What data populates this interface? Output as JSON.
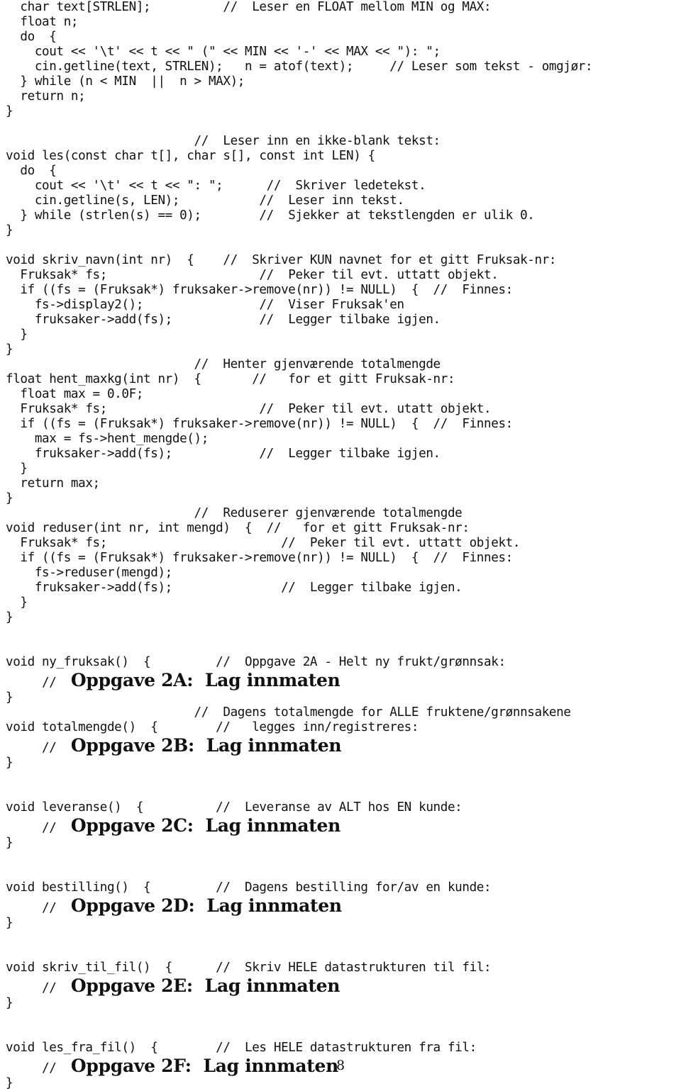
{
  "document": {
    "page_number": "8",
    "language": "no",
    "listing_type": "cpp-source-code"
  },
  "lines": [
    {
      "kind": "code",
      "text": "  char text[STRLEN];          //  Leser en FLOAT mellom MIN og MAX:"
    },
    {
      "kind": "code",
      "text": "  float n;"
    },
    {
      "kind": "code",
      "text": "  do  {"
    },
    {
      "kind": "code",
      "text": "    cout << '\\t' << t << \" (\" << MIN << '-' << MAX << \"): \";"
    },
    {
      "kind": "code",
      "text": "    cin.getline(text, STRLEN);   n = atof(text);     // Leser som tekst - omgjør:"
    },
    {
      "kind": "code",
      "text": "  } while (n < MIN  ||  n > MAX);"
    },
    {
      "kind": "code",
      "text": "  return n;"
    },
    {
      "kind": "code",
      "text": "}"
    },
    {
      "kind": "blank",
      "text": ""
    },
    {
      "kind": "code",
      "text": "                          //  Leser inn en ikke-blank tekst:"
    },
    {
      "kind": "code",
      "text": "void les(const char t[], char s[], const int LEN) {"
    },
    {
      "kind": "code",
      "text": "  do  {"
    },
    {
      "kind": "code",
      "text": "    cout << '\\t' << t << \": \";      //  Skriver ledetekst."
    },
    {
      "kind": "code",
      "text": "    cin.getline(s, LEN);           //  Leser inn tekst."
    },
    {
      "kind": "code",
      "text": "  } while (strlen(s) == 0);        //  Sjekker at tekstlengden er ulik 0."
    },
    {
      "kind": "code",
      "text": "}"
    },
    {
      "kind": "blank",
      "text": ""
    },
    {
      "kind": "code",
      "text": "void skriv_navn(int nr)  {    //  Skriver KUN navnet for et gitt Fruksak-nr:"
    },
    {
      "kind": "code",
      "text": "  Fruksak* fs;                     //  Peker til evt. uttatt objekt."
    },
    {
      "kind": "code",
      "text": "  if ((fs = (Fruksak*) fruksaker->remove(nr)) != NULL)  {  //  Finnes:"
    },
    {
      "kind": "code",
      "text": "    fs->display2();                //  Viser Fruksak'en"
    },
    {
      "kind": "code",
      "text": "    fruksaker->add(fs);            //  Legger tilbake igjen."
    },
    {
      "kind": "code",
      "text": "  }"
    },
    {
      "kind": "code",
      "text": "}"
    },
    {
      "kind": "code",
      "text": "                          //  Henter gjenværende totalmengde"
    },
    {
      "kind": "code",
      "text": "float hent_maxkg(int nr)  {       //   for et gitt Fruksak-nr:"
    },
    {
      "kind": "code",
      "text": "  float max = 0.0F;"
    },
    {
      "kind": "code",
      "text": "  Fruksak* fs;                     //  Peker til evt. utatt objekt."
    },
    {
      "kind": "code",
      "text": "  if ((fs = (Fruksak*) fruksaker->remove(nr)) != NULL)  {  //  Finnes:"
    },
    {
      "kind": "code",
      "text": "    max = fs->hent_mengde();"
    },
    {
      "kind": "code",
      "text": "    fruksaker->add(fs);            //  Legger tilbake igjen."
    },
    {
      "kind": "code",
      "text": "  }"
    },
    {
      "kind": "code",
      "text": "  return max;"
    },
    {
      "kind": "code",
      "text": "}"
    },
    {
      "kind": "code",
      "text": "                          //  Reduserer gjenværende totalmengde"
    },
    {
      "kind": "code",
      "text": "void reduser(int nr, int mengd)  {  //   for et gitt Fruksak-nr:"
    },
    {
      "kind": "code",
      "text": "  Fruksak* fs;                        //  Peker til evt. uttatt objekt."
    },
    {
      "kind": "code",
      "text": "  if ((fs = (Fruksak*) fruksaker->remove(nr)) != NULL)  {  //  Finnes:"
    },
    {
      "kind": "code",
      "text": "    fs->reduser(mengd);"
    },
    {
      "kind": "code",
      "text": "    fruksaker->add(fs);               //  Legger tilbake igjen."
    },
    {
      "kind": "code",
      "text": "  }"
    },
    {
      "kind": "code",
      "text": "}"
    },
    {
      "kind": "blank",
      "text": ""
    },
    {
      "kind": "blank",
      "text": ""
    },
    {
      "kind": "code",
      "text": "void ny_fruksak()  {         //  Oppgave 2A - Helt ny frukt/grønnsak:"
    },
    {
      "kind": "task",
      "slashes": "     //  ",
      "task_text": "Oppgave 2A:  Lag innmaten"
    },
    {
      "kind": "code",
      "text": "}"
    },
    {
      "kind": "code",
      "text": "                          //  Dagens totalmengde for ALLE fruktene/grønnsakene"
    },
    {
      "kind": "code",
      "text": "void totalmengde()  {        //   legges inn/registreres:"
    },
    {
      "kind": "task",
      "slashes": "     //  ",
      "task_text": "Oppgave 2B:  Lag innmaten"
    },
    {
      "kind": "code",
      "text": "}"
    },
    {
      "kind": "blank",
      "text": ""
    },
    {
      "kind": "blank",
      "text": ""
    },
    {
      "kind": "code",
      "text": "void leveranse()  {          //  Leveranse av ALT hos EN kunde:"
    },
    {
      "kind": "task",
      "slashes": "     //  ",
      "task_text": "Oppgave 2C:  Lag innmaten"
    },
    {
      "kind": "code",
      "text": "}"
    },
    {
      "kind": "blank",
      "text": ""
    },
    {
      "kind": "blank",
      "text": ""
    },
    {
      "kind": "code",
      "text": "void bestilling()  {         //  Dagens bestilling for/av en kunde:"
    },
    {
      "kind": "task",
      "slashes": "     //  ",
      "task_text": "Oppgave 2D:  Lag innmaten"
    },
    {
      "kind": "code",
      "text": "}"
    },
    {
      "kind": "blank",
      "text": ""
    },
    {
      "kind": "blank",
      "text": ""
    },
    {
      "kind": "code",
      "text": "void skriv_til_fil()  {      //  Skriv HELE datastrukturen til fil:"
    },
    {
      "kind": "task",
      "slashes": "     //  ",
      "task_text": "Oppgave 2E:  Lag innmaten"
    },
    {
      "kind": "code",
      "text": "}"
    },
    {
      "kind": "blank",
      "text": ""
    },
    {
      "kind": "blank",
      "text": ""
    },
    {
      "kind": "code",
      "text": "void les_fra_fil()  {        //  Les HELE datastrukturen fra fil:"
    },
    {
      "kind": "task",
      "slashes": "     //  ",
      "task_text": "Oppgave 2F:  Lag innmaten"
    },
    {
      "kind": "code",
      "text": "}"
    }
  ]
}
